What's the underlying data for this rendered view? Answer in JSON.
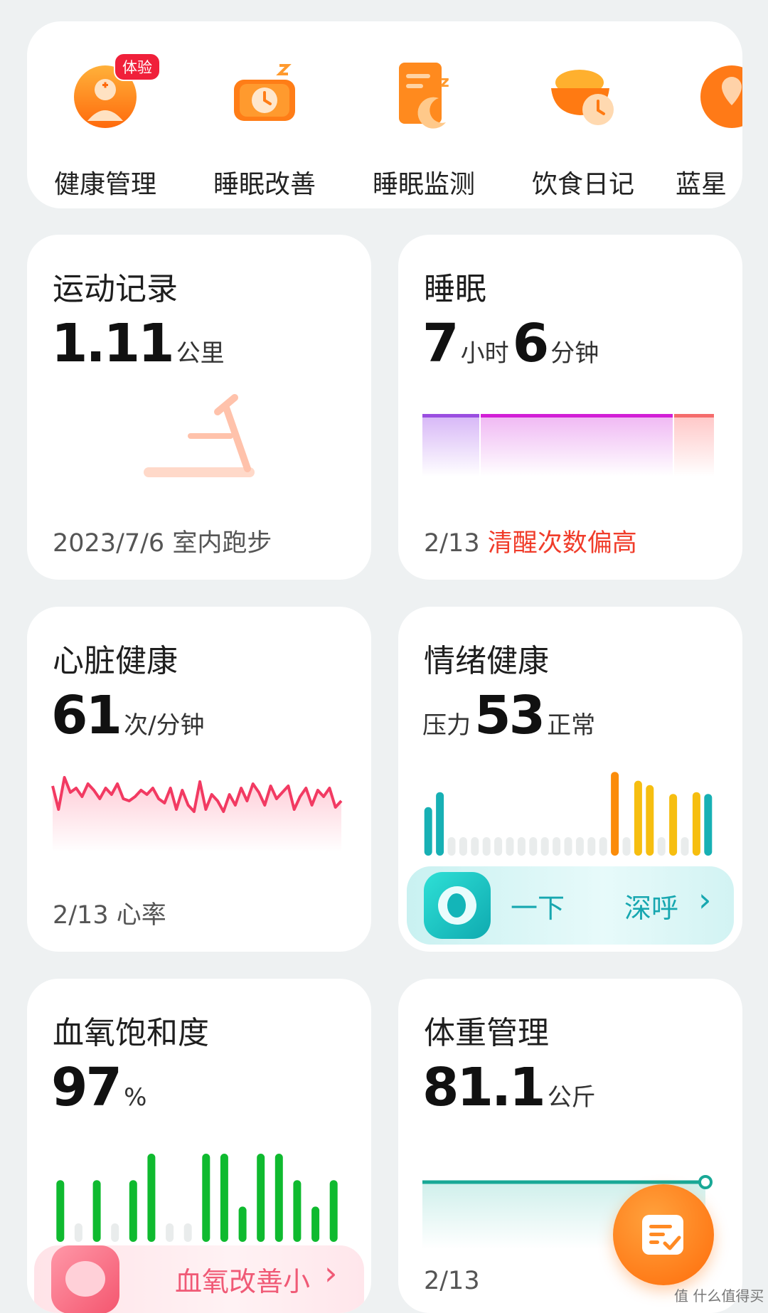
{
  "shortcuts": {
    "items": [
      {
        "label": "健康管理",
        "badge": "体验",
        "icon": "health-management-icon"
      },
      {
        "label": "睡眠改善",
        "icon": "sleep-improve-icon"
      },
      {
        "label": "睡眠监测",
        "icon": "sleep-monitor-icon"
      },
      {
        "label": "饮食日记",
        "icon": "diet-diary-icon"
      },
      {
        "label": "蓝星",
        "icon": "blue-star-icon"
      }
    ]
  },
  "exercise": {
    "title": "运动记录",
    "value": "1.11",
    "unit": "公里",
    "date": "2023/7/6",
    "activity": "室内跑步",
    "icon": "treadmill-icon"
  },
  "sleep": {
    "title": "睡眠",
    "hours": "7",
    "hours_unit": "小时",
    "minutes": "6",
    "minutes_unit": "分钟",
    "date": "2/13",
    "note": "清醒次数偏高"
  },
  "heart": {
    "title": "心脏健康",
    "value": "61",
    "unit": "次/分钟",
    "date": "2/13",
    "label": "心率",
    "chart_data": {
      "type": "line",
      "series": [
        {
          "values": [
            62,
            40,
            70,
            56,
            60,
            52,
            64,
            58,
            50,
            60,
            54,
            64,
            50,
            48,
            52,
            58,
            54,
            60,
            50,
            46,
            60,
            40,
            58,
            44,
            38,
            66,
            40,
            54,
            48,
            38,
            54,
            44,
            60,
            48,
            64,
            56,
            44,
            62,
            50,
            56,
            62,
            40,
            52,
            60,
            44,
            58,
            52,
            60,
            42,
            48
          ]
        }
      ]
    }
  },
  "mood": {
    "title": "情绪健康",
    "prefix": "压力",
    "value": "53",
    "status": "正常",
    "banner_text": "一下",
    "banner_text2": "深呼",
    "chart_data": {
      "type": "bar",
      "values": [
        55,
        72,
        0,
        0,
        0,
        0,
        0,
        0,
        0,
        0,
        0,
        0,
        0,
        0,
        0,
        0,
        95,
        0,
        85,
        80,
        0,
        70,
        0,
        72,
        70
      ],
      "colors": [
        "#17b0b4",
        "#17b0b4",
        "#e9ecec",
        "#e9ecec",
        "#e9ecec",
        "#e9ecec",
        "#e9ecec",
        "#e9ecec",
        "#e9ecec",
        "#e9ecec",
        "#e9ecec",
        "#e9ecec",
        "#e9ecec",
        "#e9ecec",
        "#e9ecec",
        "#e9ecec",
        "#fb8c0a",
        "#e9ecec",
        "#f6be10",
        "#f6be10",
        "#e9ecec",
        "#f6be10",
        "#e9ecec",
        "#f6be10",
        "#17b0b4"
      ]
    }
  },
  "spo2": {
    "title": "血氧饱和度",
    "value": "97",
    "unit": "%",
    "banner_text": "血氧改善小",
    "chart_data": {
      "type": "bar",
      "values": [
        70,
        0,
        70,
        0,
        70,
        100,
        0,
        0,
        100,
        100,
        40,
        100,
        100,
        70,
        40,
        70
      ],
      "colors": [
        "#0fba2f",
        "#e9ecec",
        "#0fba2f",
        "#e9ecec",
        "#0fba2f",
        "#0fba2f",
        "#e9ecec",
        "#e9ecec",
        "#0fba2f",
        "#0fba2f",
        "#0fba2f",
        "#0fba2f",
        "#0fba2f",
        "#0fba2f",
        "#0fba2f",
        "#0fba2f"
      ]
    }
  },
  "weight": {
    "title": "体重管理",
    "value": "81.1",
    "unit": "公斤",
    "date": "2/13"
  },
  "watermark": "值 什么值得买"
}
